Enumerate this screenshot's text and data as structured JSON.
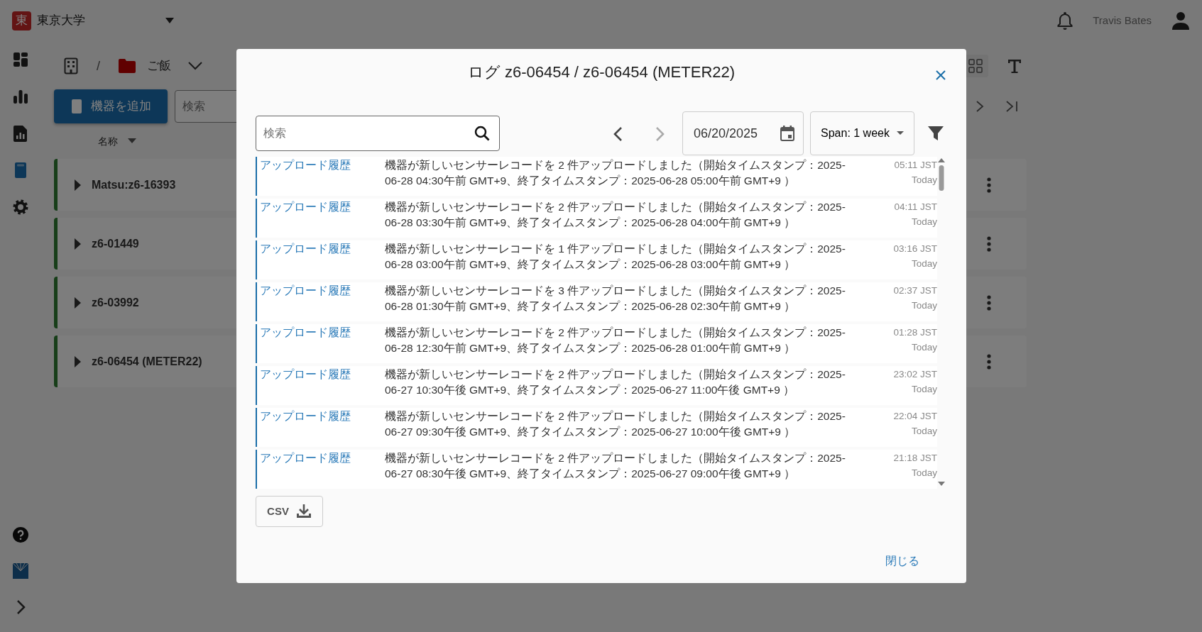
{
  "app": {
    "logo_letter": "東",
    "org": "東京大学",
    "user": "Travis Bates"
  },
  "sidebar": {
    "items": [
      {
        "kind": "dashboard",
        "selected": false
      },
      {
        "kind": "chart",
        "selected": false
      },
      {
        "kind": "report",
        "selected": false
      },
      {
        "kind": "device",
        "selected": true
      },
      {
        "kind": "settings",
        "selected": false
      }
    ],
    "bottom": [
      {
        "kind": "help"
      },
      {
        "kind": "brand"
      },
      {
        "kind": "expand"
      }
    ]
  },
  "breadcrumb": {
    "separator": "/",
    "folder": "ご飯"
  },
  "toolbar": {
    "add_button": "機器を追加",
    "search_placeholder": "検索"
  },
  "list_header": {
    "sort_column": "名称"
  },
  "devices": [
    {
      "name": "Matsu:z6-16393",
      "expanded": false
    },
    {
      "name": "z6-01449",
      "expanded": false
    },
    {
      "name": "z6-03992",
      "expanded": false
    },
    {
      "name": "z6-06454 (METER22)",
      "expanded": false
    }
  ],
  "modal": {
    "title": "ログ z6-06454 / z6-06454 (METER22)",
    "search_placeholder": "検索",
    "prev_disabled": false,
    "next_disabled": true,
    "date": "06/20/2025",
    "span": "Span: 1 week",
    "entries": [
      {
        "category": "アップロード履歴",
        "message": "機器が新しいセンサーレコードを 2 件アップロードしました（開始タイムスタンプ：2025-06-28 04:30午前 GMT+9、終了タイムスタンプ：2025-06-28 05:00午前 GMT+9 ）",
        "time": "05:11 JST",
        "day": "Today"
      },
      {
        "category": "アップロード履歴",
        "message": "機器が新しいセンサーレコードを 2 件アップロードしました（開始タイムスタンプ：2025-06-28 03:30午前 GMT+9、終了タイムスタンプ：2025-06-28 04:00午前 GMT+9 ）",
        "time": "04:11 JST",
        "day": "Today"
      },
      {
        "category": "アップロード履歴",
        "message": "機器が新しいセンサーレコードを 1 件アップロードしました（開始タイムスタンプ：2025-06-28 03:00午前 GMT+9、終了タイムスタンプ：2025-06-28 03:00午前 GMT+9 ）",
        "time": "03:16 JST",
        "day": "Today"
      },
      {
        "category": "アップロード履歴",
        "message": "機器が新しいセンサーレコードを 3 件アップロードしました（開始タイムスタンプ：2025-06-28 01:30午前 GMT+9、終了タイムスタンプ：2025-06-28 02:30午前 GMT+9 ）",
        "time": "02:37 JST",
        "day": "Today"
      },
      {
        "category": "アップロード履歴",
        "message": "機器が新しいセンサーレコードを 2 件アップロードしました（開始タイムスタンプ：2025-06-28 12:30午前 GMT+9、終了タイムスタンプ：2025-06-28 01:00午前 GMT+9 ）",
        "time": "01:28 JST",
        "day": "Today"
      },
      {
        "category": "アップロード履歴",
        "message": "機器が新しいセンサーレコードを 2 件アップロードしました（開始タイムスタンプ：2025-06-27 10:30午後 GMT+9、終了タイムスタンプ：2025-06-27 11:00午後 GMT+9 ）",
        "time": "23:02 JST",
        "day": "Today"
      },
      {
        "category": "アップロード履歴",
        "message": "機器が新しいセンサーレコードを 2 件アップロードしました（開始タイムスタンプ：2025-06-27 09:30午後 GMT+9、終了タイムスタンプ：2025-06-27 10:00午後 GMT+9 ）",
        "time": "22:04 JST",
        "day": "Today"
      },
      {
        "category": "アップロード履歴",
        "message": "機器が新しいセンサーレコードを 2 件アップロードしました（開始タイムスタンプ：2025-06-27 08:30午後 GMT+9、終了タイムスタンプ：2025-06-27 09:00午後 GMT+9 ）",
        "time": "21:18 JST",
        "day": "Today"
      }
    ],
    "csv_button": "CSV",
    "close_button": "閉じる"
  }
}
